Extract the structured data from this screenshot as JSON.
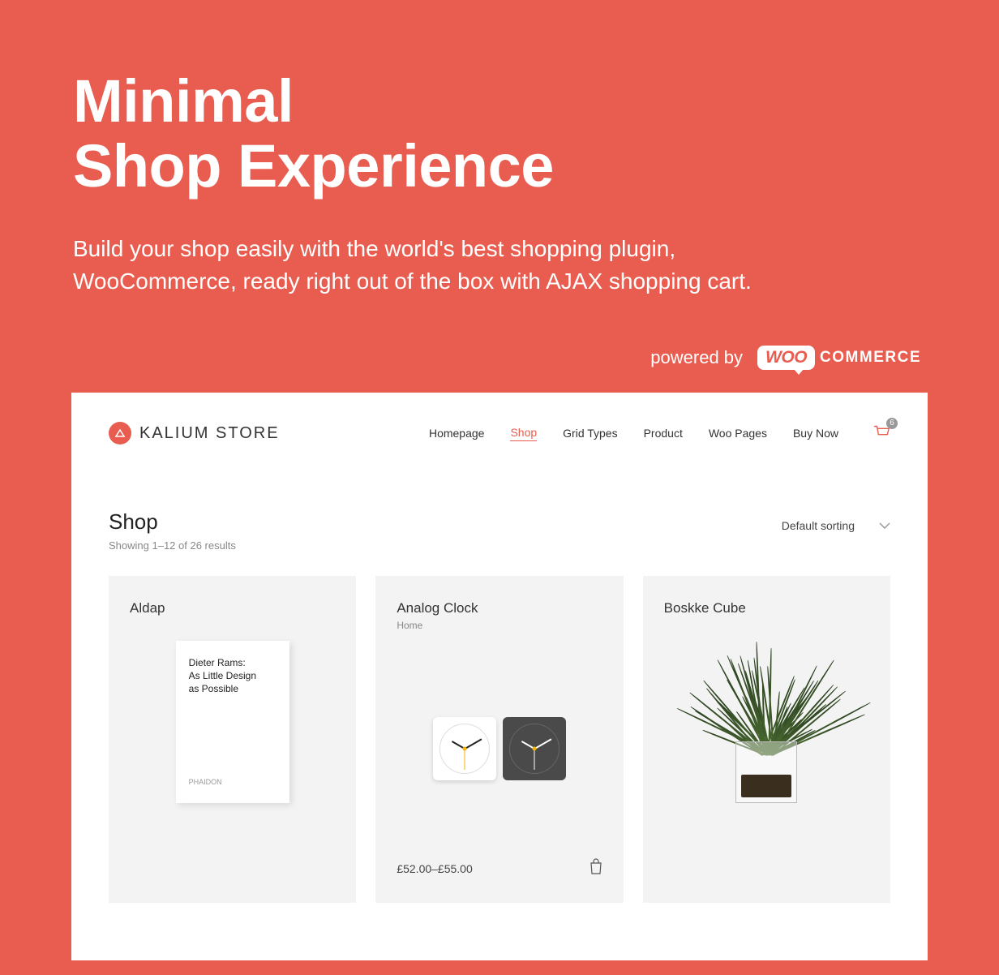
{
  "hero": {
    "title_line1": "Minimal",
    "title_line2": "Shop Experience",
    "subtitle": "Build your shop easily with the world's best shopping plugin, WooCommerce, ready right out of the box with AJAX shopping cart."
  },
  "powered": {
    "label": "powered by",
    "woo": "WOO",
    "commerce": "COMMERCE"
  },
  "site": {
    "brand": "KALIUM STORE",
    "nav": [
      {
        "label": "Homepage",
        "active": false
      },
      {
        "label": "Shop",
        "active": true
      },
      {
        "label": "Grid Types",
        "active": false
      },
      {
        "label": "Product",
        "active": false
      },
      {
        "label": "Woo Pages",
        "active": false
      },
      {
        "label": "Buy Now",
        "active": false
      }
    ],
    "cart_count": "6",
    "page_title": "Shop",
    "result_count": "Showing 1–12 of 26 results",
    "sort_label": "Default sorting",
    "products": [
      {
        "title": "Aldap",
        "category": "",
        "book_line1": "Dieter Rams:",
        "book_line2": "As Little Design",
        "book_line3": "as Possible",
        "book_pub": "PHAIDON"
      },
      {
        "title": "Analog Clock",
        "category": "Home",
        "price": "£52.00–£55.00"
      },
      {
        "title": "Boskke Cube",
        "category": ""
      }
    ]
  }
}
